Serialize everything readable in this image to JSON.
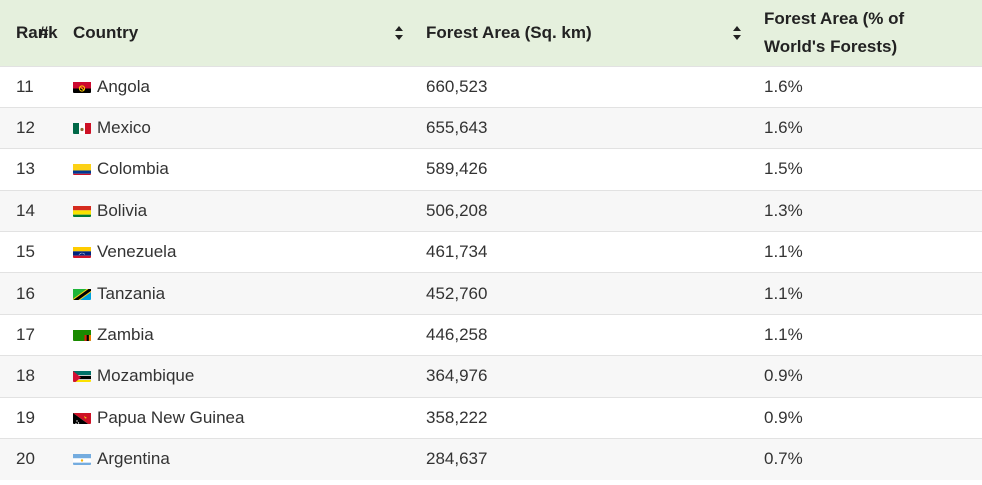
{
  "table": {
    "headers": {
      "rank": "Rank",
      "rank_symbol": "#",
      "country": "Country",
      "area": "Forest Area (Sq. km)",
      "pct_line1": "Forest Area (% of",
      "pct_line2": "World's Forests)"
    },
    "rows": [
      {
        "rank": "11",
        "country": "Angola",
        "flag": "angola-flag-icon",
        "area": "660,523",
        "pct": "1.6%"
      },
      {
        "rank": "12",
        "country": "Mexico",
        "flag": "mexico-flag-icon",
        "area": "655,643",
        "pct": "1.6%"
      },
      {
        "rank": "13",
        "country": "Colombia",
        "flag": "colombia-flag-icon",
        "area": "589,426",
        "pct": "1.5%"
      },
      {
        "rank": "14",
        "country": "Bolivia",
        "flag": "bolivia-flag-icon",
        "area": "506,208",
        "pct": "1.3%"
      },
      {
        "rank": "15",
        "country": "Venezuela",
        "flag": "venezuela-flag-icon",
        "area": "461,734",
        "pct": "1.1%"
      },
      {
        "rank": "16",
        "country": "Tanzania",
        "flag": "tanzania-flag-icon",
        "area": "452,760",
        "pct": "1.1%"
      },
      {
        "rank": "17",
        "country": "Zambia",
        "flag": "zambia-flag-icon",
        "area": "446,258",
        "pct": "1.1%"
      },
      {
        "rank": "18",
        "country": "Mozambique",
        "flag": "mozambique-flag-icon",
        "area": "364,976",
        "pct": "0.9%"
      },
      {
        "rank": "19",
        "country": "Papua New Guinea",
        "flag": "papua-new-guinea-flag-icon",
        "area": "358,222",
        "pct": "0.9%"
      },
      {
        "rank": "20",
        "country": "Argentina",
        "flag": "argentina-flag-icon",
        "area": "284,637",
        "pct": "0.7%"
      }
    ]
  },
  "colors": {
    "header_bg": "#e5f0dd",
    "row_alt_bg": "#f7f7f7",
    "border": "#e2e2e2",
    "text": "#333333"
  }
}
